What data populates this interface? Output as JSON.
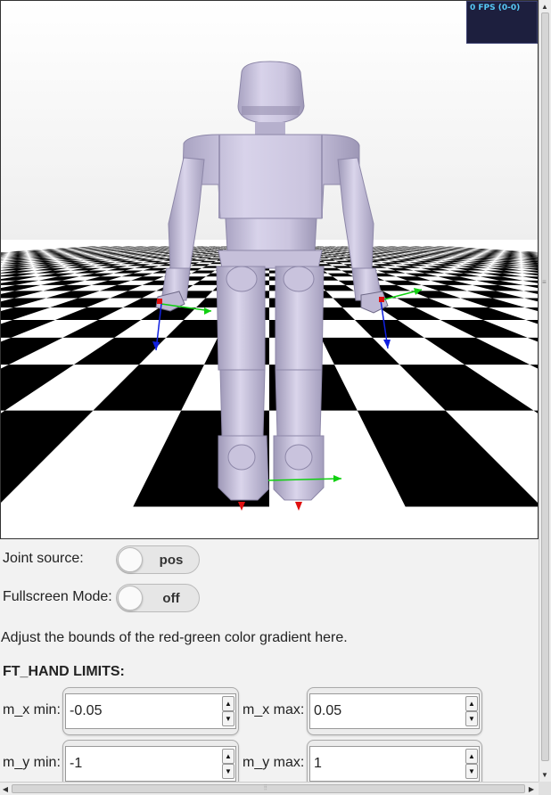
{
  "viewport": {
    "fps_readout": "0 FPS (0-0)",
    "colors": {
      "robot": "#cdc7e2",
      "floor_dark": "#000000",
      "floor_light": "#ffffff",
      "sky": "#f5f5f5",
      "axis_x": "#e01010",
      "axis_y": "#10d010",
      "axis_z": "#1020e0"
    }
  },
  "controls": {
    "joint_source": {
      "label": "Joint source:",
      "value": "pos"
    },
    "fullscreen": {
      "label": "Fullscreen Mode:",
      "value": "off"
    }
  },
  "gradient_note": "Adjust the bounds of the red-green color gradient here.",
  "ft_hand": {
    "title": "FT_HAND LIMITS:",
    "mx_min_label": "m_x min:",
    "mx_min_value": "-0.05",
    "mx_max_label": "m_x max:",
    "mx_max_value": "0.05",
    "my_min_label": "m_y min:",
    "my_min_value": "-1",
    "my_max_label": "m_y max:",
    "my_max_value": "1"
  },
  "scrollbars": {
    "up_icon": "up-arrow-icon",
    "down_icon": "down-arrow-icon",
    "left_icon": "left-arrow-icon",
    "right_icon": "right-arrow-icon"
  }
}
